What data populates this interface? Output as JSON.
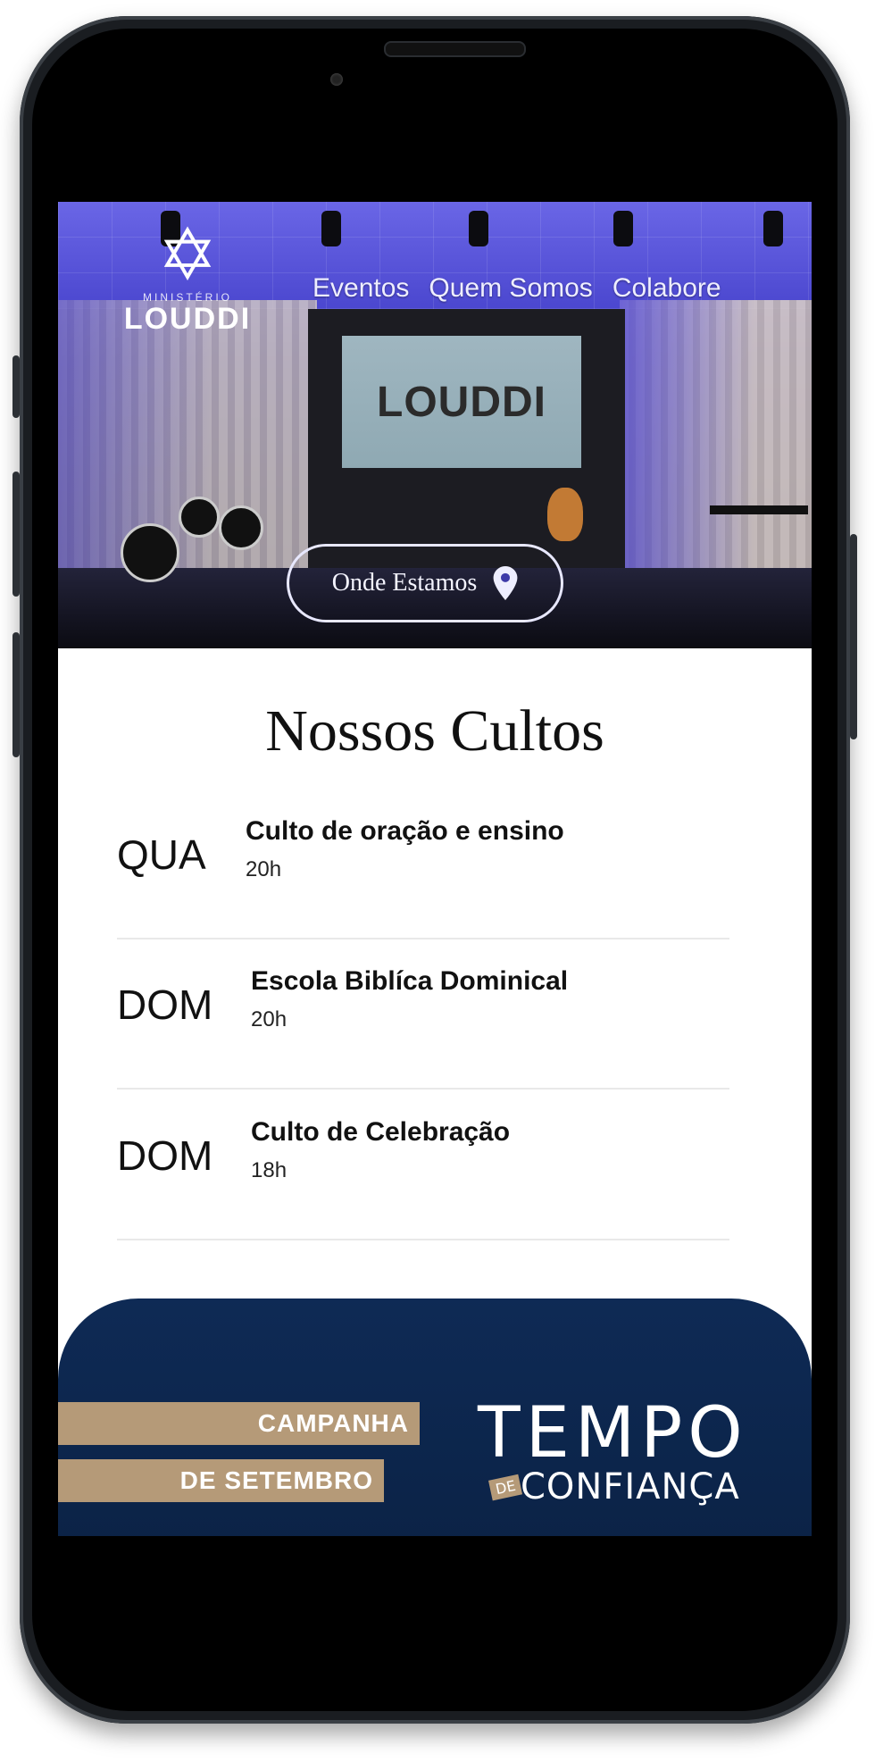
{
  "header": {
    "logo": {
      "top_text": "MINISTÉRIO",
      "name": "LOUDDI"
    },
    "nav": [
      "Eventos",
      "Quem Somos",
      "Colabore"
    ],
    "location_button": "Onde Estamos"
  },
  "hero": {
    "projector_text": "LOUDDI"
  },
  "services": {
    "title": "Nossos Cultos",
    "items": [
      {
        "day": "QUA",
        "name": "Culto de oração e ensino",
        "time": "20h"
      },
      {
        "day": "DOM",
        "name": "Escola Biblíca Dominical",
        "time": "20h"
      },
      {
        "day": "DOM",
        "name": "Culto de Celebração",
        "time": "18h"
      }
    ]
  },
  "banner": {
    "band1": "CAMPANHA",
    "band2": "DE SETEMBRO",
    "title_big": "TEMPO",
    "title_de": "DE",
    "title_sub": "CONFIANÇA"
  },
  "icons": {
    "location": "map-pin-icon",
    "logo": "star-of-david-lion-icon"
  },
  "colors": {
    "hero": "#4d49d2",
    "banner": "#0e2a55",
    "band": "#b59a78"
  }
}
